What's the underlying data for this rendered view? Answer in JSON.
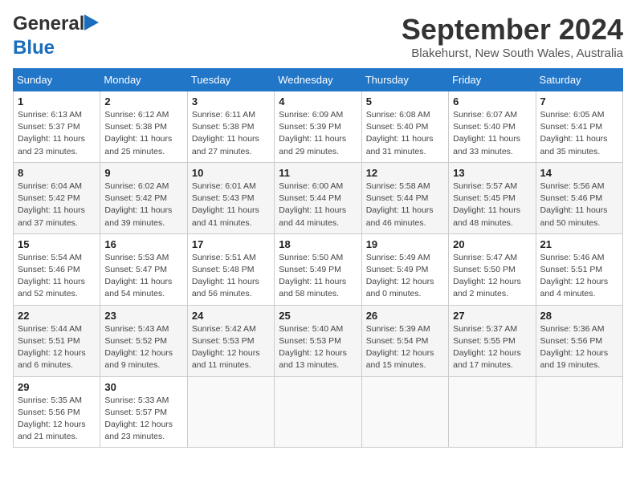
{
  "header": {
    "logo_line1": "General",
    "logo_line2": "Blue",
    "title": "September 2024",
    "location": "Blakehurst, New South Wales, Australia"
  },
  "days_of_week": [
    "Sunday",
    "Monday",
    "Tuesday",
    "Wednesday",
    "Thursday",
    "Friday",
    "Saturday"
  ],
  "weeks": [
    [
      {
        "day": "1",
        "info": "Sunrise: 6:13 AM\nSunset: 5:37 PM\nDaylight: 11 hours\nand 23 minutes."
      },
      {
        "day": "2",
        "info": "Sunrise: 6:12 AM\nSunset: 5:38 PM\nDaylight: 11 hours\nand 25 minutes."
      },
      {
        "day": "3",
        "info": "Sunrise: 6:11 AM\nSunset: 5:38 PM\nDaylight: 11 hours\nand 27 minutes."
      },
      {
        "day": "4",
        "info": "Sunrise: 6:09 AM\nSunset: 5:39 PM\nDaylight: 11 hours\nand 29 minutes."
      },
      {
        "day": "5",
        "info": "Sunrise: 6:08 AM\nSunset: 5:40 PM\nDaylight: 11 hours\nand 31 minutes."
      },
      {
        "day": "6",
        "info": "Sunrise: 6:07 AM\nSunset: 5:40 PM\nDaylight: 11 hours\nand 33 minutes."
      },
      {
        "day": "7",
        "info": "Sunrise: 6:05 AM\nSunset: 5:41 PM\nDaylight: 11 hours\nand 35 minutes."
      }
    ],
    [
      {
        "day": "8",
        "info": "Sunrise: 6:04 AM\nSunset: 5:42 PM\nDaylight: 11 hours\nand 37 minutes."
      },
      {
        "day": "9",
        "info": "Sunrise: 6:02 AM\nSunset: 5:42 PM\nDaylight: 11 hours\nand 39 minutes."
      },
      {
        "day": "10",
        "info": "Sunrise: 6:01 AM\nSunset: 5:43 PM\nDaylight: 11 hours\nand 41 minutes."
      },
      {
        "day": "11",
        "info": "Sunrise: 6:00 AM\nSunset: 5:44 PM\nDaylight: 11 hours\nand 44 minutes."
      },
      {
        "day": "12",
        "info": "Sunrise: 5:58 AM\nSunset: 5:44 PM\nDaylight: 11 hours\nand 46 minutes."
      },
      {
        "day": "13",
        "info": "Sunrise: 5:57 AM\nSunset: 5:45 PM\nDaylight: 11 hours\nand 48 minutes."
      },
      {
        "day": "14",
        "info": "Sunrise: 5:56 AM\nSunset: 5:46 PM\nDaylight: 11 hours\nand 50 minutes."
      }
    ],
    [
      {
        "day": "15",
        "info": "Sunrise: 5:54 AM\nSunset: 5:46 PM\nDaylight: 11 hours\nand 52 minutes."
      },
      {
        "day": "16",
        "info": "Sunrise: 5:53 AM\nSunset: 5:47 PM\nDaylight: 11 hours\nand 54 minutes."
      },
      {
        "day": "17",
        "info": "Sunrise: 5:51 AM\nSunset: 5:48 PM\nDaylight: 11 hours\nand 56 minutes."
      },
      {
        "day": "18",
        "info": "Sunrise: 5:50 AM\nSunset: 5:49 PM\nDaylight: 11 hours\nand 58 minutes."
      },
      {
        "day": "19",
        "info": "Sunrise: 5:49 AM\nSunset: 5:49 PM\nDaylight: 12 hours\nand 0 minutes."
      },
      {
        "day": "20",
        "info": "Sunrise: 5:47 AM\nSunset: 5:50 PM\nDaylight: 12 hours\nand 2 minutes."
      },
      {
        "day": "21",
        "info": "Sunrise: 5:46 AM\nSunset: 5:51 PM\nDaylight: 12 hours\nand 4 minutes."
      }
    ],
    [
      {
        "day": "22",
        "info": "Sunrise: 5:44 AM\nSunset: 5:51 PM\nDaylight: 12 hours\nand 6 minutes."
      },
      {
        "day": "23",
        "info": "Sunrise: 5:43 AM\nSunset: 5:52 PM\nDaylight: 12 hours\nand 9 minutes."
      },
      {
        "day": "24",
        "info": "Sunrise: 5:42 AM\nSunset: 5:53 PM\nDaylight: 12 hours\nand 11 minutes."
      },
      {
        "day": "25",
        "info": "Sunrise: 5:40 AM\nSunset: 5:53 PM\nDaylight: 12 hours\nand 13 minutes."
      },
      {
        "day": "26",
        "info": "Sunrise: 5:39 AM\nSunset: 5:54 PM\nDaylight: 12 hours\nand 15 minutes."
      },
      {
        "day": "27",
        "info": "Sunrise: 5:37 AM\nSunset: 5:55 PM\nDaylight: 12 hours\nand 17 minutes."
      },
      {
        "day": "28",
        "info": "Sunrise: 5:36 AM\nSunset: 5:56 PM\nDaylight: 12 hours\nand 19 minutes."
      }
    ],
    [
      {
        "day": "29",
        "info": "Sunrise: 5:35 AM\nSunset: 5:56 PM\nDaylight: 12 hours\nand 21 minutes."
      },
      {
        "day": "30",
        "info": "Sunrise: 5:33 AM\nSunset: 5:57 PM\nDaylight: 12 hours\nand 23 minutes."
      },
      {
        "day": "",
        "info": ""
      },
      {
        "day": "",
        "info": ""
      },
      {
        "day": "",
        "info": ""
      },
      {
        "day": "",
        "info": ""
      },
      {
        "day": "",
        "info": ""
      }
    ]
  ]
}
